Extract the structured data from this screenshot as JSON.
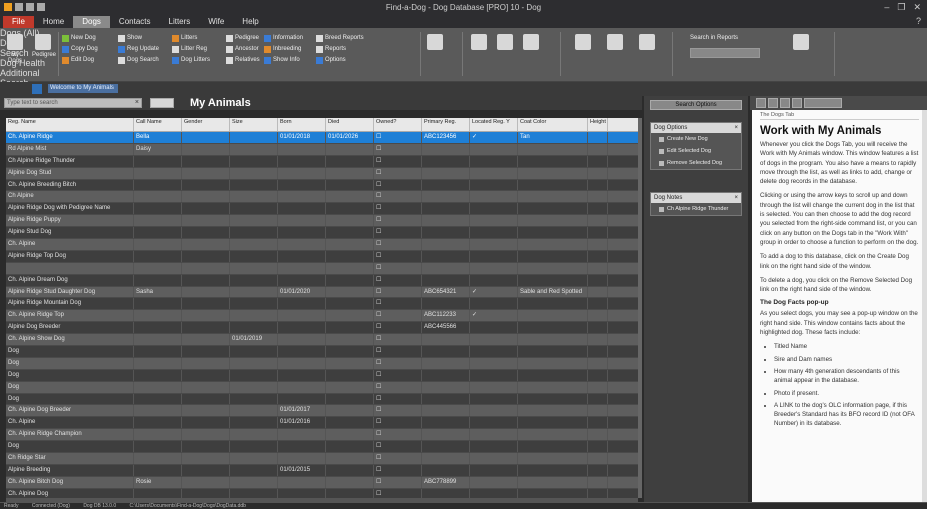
{
  "window": {
    "title": "Find-a-Dog - Dog Database [PRO] 10 - Dog",
    "controls": [
      "–",
      "❐",
      "✕"
    ]
  },
  "menu": {
    "tabs": [
      {
        "label": "File",
        "kind": "file"
      },
      {
        "label": "Home",
        "kind": ""
      },
      {
        "label": "Dogs",
        "kind": "active"
      },
      {
        "label": "Contacts",
        "kind": ""
      },
      {
        "label": "Litters",
        "kind": ""
      },
      {
        "label": "Wife",
        "kind": ""
      },
      {
        "label": "Help",
        "kind": ""
      }
    ],
    "help_icon": "?"
  },
  "ribbon": {
    "groups": [
      {
        "label": "",
        "buttons": [
          "My Dogs",
          "Pedigree"
        ]
      },
      {
        "label": "Dogs (All)",
        "buttons": []
      },
      {
        "label": "Dog Search",
        "buttons": []
      },
      {
        "label": "Dog Health",
        "buttons": []
      },
      {
        "label": "Additional",
        "buttons": []
      },
      {
        "label": "Search",
        "buttons": []
      }
    ],
    "small_buttons": [
      [
        "New Dog",
        "Copy Dog",
        "Edit Dog"
      ],
      [
        "Show",
        "Reg Update",
        "Dog Search"
      ],
      [
        "Litters",
        "Litter Reg",
        "Dog Litters"
      ],
      [
        "Pedigree",
        "Ancestor",
        "Relatives"
      ],
      [
        "Information",
        "Inbreeding",
        "Show Info"
      ]
    ],
    "extra_labels": [
      "Breed Reports",
      "Reports",
      "Options"
    ],
    "search_label": "Search in Reports"
  },
  "strip": {
    "label": "Welcome to My Animals"
  },
  "toolbar": {
    "search_placeholder": "Type text to search",
    "clear": "×",
    "heading": "My Animals"
  },
  "grid": {
    "columns": [
      "Reg. Name",
      "Call Name",
      "Gender",
      "Size",
      "Born",
      "Died",
      "Owned?",
      "Primary Reg.",
      "Located Reg. Y",
      "Coat Color",
      "Height"
    ],
    "rows": [
      {
        "style": "sel",
        "cells": [
          "Ch. Alpine Ridge",
          "Bella",
          "",
          "",
          "01/01/2018",
          "01/01/2026",
          "☐",
          "ABC123456",
          "✓",
          "Tan",
          ""
        ]
      },
      {
        "style": "alt",
        "cells": [
          "Rd Alpine Mist",
          "Daisy",
          "",
          "",
          "",
          "",
          "☐",
          "",
          "",
          "",
          ""
        ]
      },
      {
        "style": "dk",
        "cells": [
          "Ch Alpine Ridge Thunder",
          "",
          "",
          "",
          "",
          "",
          "☐",
          "",
          "",
          "",
          ""
        ]
      },
      {
        "style": "alt",
        "cells": [
          "Alpine Dog Stud",
          "",
          "",
          "",
          "",
          "",
          "☐",
          "",
          "",
          "",
          ""
        ]
      },
      {
        "style": "dk",
        "cells": [
          "Ch. Alpine Breeding Bitch",
          "",
          "",
          "",
          "",
          "",
          "☐",
          "",
          "",
          "",
          ""
        ]
      },
      {
        "style": "alt",
        "cells": [
          "Ch Alpine",
          "",
          "",
          "",
          "",
          "",
          "☐",
          "",
          "",
          "",
          ""
        ]
      },
      {
        "style": "dk",
        "cells": [
          "Alpine Ridge Dog with Pedigree Name",
          "",
          "",
          "",
          "",
          "",
          "☐",
          "",
          "",
          "",
          ""
        ]
      },
      {
        "style": "alt",
        "cells": [
          "Alpine Ridge Puppy",
          "",
          "",
          "",
          "",
          "",
          "☐",
          "",
          "",
          "",
          ""
        ]
      },
      {
        "style": "dk",
        "cells": [
          "Alpine Stud Dog",
          "",
          "",
          "",
          "",
          "",
          "☐",
          "",
          "",
          "",
          ""
        ]
      },
      {
        "style": "alt",
        "cells": [
          "Ch. Alpine",
          "",
          "",
          "",
          "",
          "",
          "☐",
          "",
          "",
          "",
          ""
        ]
      },
      {
        "style": "dk",
        "cells": [
          "Alpine Ridge Top Dog",
          "",
          "",
          "",
          "",
          "",
          "☐",
          "",
          "",
          "",
          ""
        ]
      },
      {
        "style": "alt",
        "cells": [
          "",
          "",
          "",
          "",
          "",
          "",
          "☐",
          "",
          "",
          "",
          ""
        ]
      },
      {
        "style": "dk",
        "cells": [
          "Ch. Alpine Dream Dog",
          "",
          "",
          "",
          "",
          "",
          "☐",
          "",
          "",
          "",
          ""
        ]
      },
      {
        "style": "alt",
        "cells": [
          "Alpine Ridge Stud Daughter Dog",
          "Sasha",
          "",
          "",
          "01/01/2020",
          "",
          "☐",
          "ABC654321",
          "✓",
          "Sable and Red Spotted",
          ""
        ]
      },
      {
        "style": "dk",
        "cells": [
          "Alpine Ridge Mountain Dog",
          "",
          "",
          "",
          "",
          "",
          "☐",
          "",
          "",
          "",
          ""
        ]
      },
      {
        "style": "alt",
        "cells": [
          "Ch. Alpine Ridge Top",
          "",
          "",
          "",
          "",
          "",
          "☐",
          "ABC112233",
          "✓",
          "",
          ""
        ]
      },
      {
        "style": "dk",
        "cells": [
          "Alpine Dog Breeder",
          "",
          "",
          "",
          "",
          "",
          "☐",
          "ABC445566",
          "",
          "",
          ""
        ]
      },
      {
        "style": "alt",
        "cells": [
          "Ch. Alpine Show Dog",
          "",
          "",
          "01/01/2019",
          "",
          "",
          "☐",
          "",
          "",
          "",
          ""
        ]
      },
      {
        "style": "dk",
        "cells": [
          "Dog",
          "",
          "",
          "",
          "",
          "",
          "☐",
          "",
          "",
          "",
          ""
        ]
      },
      {
        "style": "alt",
        "cells": [
          "Dog",
          "",
          "",
          "",
          "",
          "",
          "☐",
          "",
          "",
          "",
          ""
        ]
      },
      {
        "style": "dk",
        "cells": [
          "Dog",
          "",
          "",
          "",
          "",
          "",
          "☐",
          "",
          "",
          "",
          ""
        ]
      },
      {
        "style": "alt",
        "cells": [
          "Dog",
          "",
          "",
          "",
          "",
          "",
          "☐",
          "",
          "",
          "",
          ""
        ]
      },
      {
        "style": "dk",
        "cells": [
          "Dog",
          "",
          "",
          "",
          "",
          "",
          "☐",
          "",
          "",
          "",
          ""
        ]
      },
      {
        "style": "alt",
        "cells": [
          "Ch. Alpine Dog Breeder",
          "",
          "",
          "",
          "01/01/2017",
          "",
          "☐",
          "",
          "",
          "",
          ""
        ]
      },
      {
        "style": "dk",
        "cells": [
          "Ch. Alpine",
          "",
          "",
          "",
          "01/01/2016",
          "",
          "☐",
          "",
          "",
          "",
          ""
        ]
      },
      {
        "style": "alt",
        "cells": [
          "Ch. Alpine Ridge Champion",
          "",
          "",
          "",
          "",
          "",
          "☐",
          "",
          "",
          "",
          ""
        ]
      },
      {
        "style": "dk",
        "cells": [
          "Dog",
          "",
          "",
          "",
          "",
          "",
          "☐",
          "",
          "",
          "",
          ""
        ]
      },
      {
        "style": "alt",
        "cells": [
          "Ch Ridge Star",
          "",
          "",
          "",
          "",
          "",
          "☐",
          "",
          "",
          "",
          ""
        ]
      },
      {
        "style": "dk",
        "cells": [
          "Alpine Breeding",
          "",
          "",
          "",
          "01/01/2015",
          "",
          "☐",
          "",
          "",
          "",
          ""
        ]
      },
      {
        "style": "alt",
        "cells": [
          "Ch. Alpine Bitch Dog",
          "Rosie",
          "",
          "",
          "",
          "",
          "☐",
          "ABC778899",
          "",
          "",
          ""
        ]
      },
      {
        "style": "dk",
        "cells": [
          "Ch. Alpine Dog",
          "",
          "",
          "",
          "",
          "",
          "☐",
          "",
          "",
          "",
          ""
        ]
      },
      {
        "style": "alt",
        "cells": [
          "Dog",
          "",
          "",
          "",
          "",
          "",
          "☐",
          "",
          "",
          "",
          ""
        ]
      },
      {
        "style": "dk",
        "cells": [
          "Ch. Alpine",
          "",
          "",
          "",
          "",
          "",
          "☐",
          "",
          "",
          "",
          ""
        ]
      }
    ]
  },
  "midpanel": {
    "top_button": "Search Options",
    "box1": {
      "title": "Dog Options",
      "close": "×",
      "items": [
        "Create New Dog",
        "Edit Selected Dog",
        "Remove Selected Dog"
      ]
    },
    "box2": {
      "title": "Dog Notes",
      "close": "×",
      "items": [
        "Ch Alpine Ridge Thunder"
      ]
    }
  },
  "help": {
    "crumb": "The Dogs Tab",
    "title": "Work with My Animals",
    "paragraphs": [
      "Whenever you click the Dogs Tab, you will receive the Work with My Animals window. This window features a list of dogs in the program. You also have a means to rapidly move through the list, as well as links to add, change or delete dog records in the database.",
      "Clicking or using the arrow keys to scroll up and down through the list will change the current dog in the list that is selected. You can then choose to add the dog record you selected from the right-side command list, or you can click on any button on the Dogs tab in the \"Work With\" group in order to choose a function to perform on the dog.",
      "To add a dog to this database, click on the Create Dog link on the right hand side of the window.",
      "To delete a dog, you click on the Remove Selected Dog link on the right hand side of the window."
    ],
    "subheading": "The Dog Facts pop-up",
    "intro": "As you select dogs, you may see a pop-up window on the right hand side. This window contains facts about the highlighted dog. These facts include:",
    "bullets": [
      "Titled Name",
      "Sire and Dam names",
      "How many 4th generation descendants of this animal appear in the database.",
      "Photo if present.",
      "A LINK to the dog's OLC information page, if this Breeder's Standard has its BFO record ID (not OFA Number) in its database."
    ]
  },
  "status": {
    "items": [
      "Ready",
      "Connected (Dog)",
      "Dog DB 13.0.0",
      "C:\\Users\\Documents\\Find-a-Dog\\Dogs\\DogData.ddb"
    ]
  }
}
